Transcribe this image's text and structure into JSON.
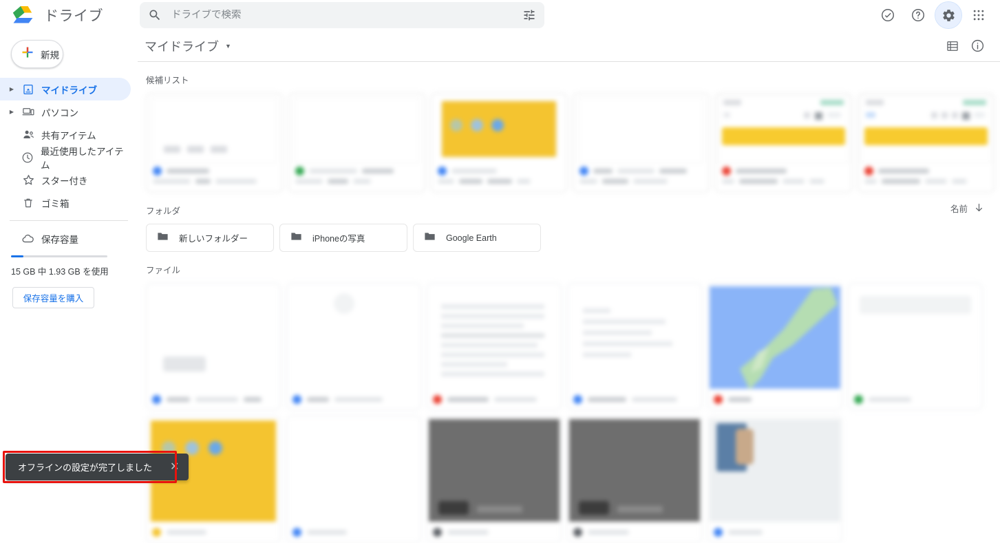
{
  "app": {
    "brand_name": "ドライブ",
    "logo_icon": "google-drive-logo"
  },
  "search": {
    "placeholder": "ドライブで検索",
    "value": "",
    "search_icon": "search-icon",
    "filter_icon": "tune-filter-icon"
  },
  "top_right": {
    "offline_status_icon": "check-circle-icon",
    "help_icon": "help-circle-icon",
    "settings_icon": "gear-icon",
    "settings_active": true,
    "apps_icon": "apps-grid-icon"
  },
  "sidebar": {
    "new_button": {
      "label": "新規",
      "icon": "plus-icon"
    },
    "items": [
      {
        "label": "マイドライブ",
        "icon": "my-drive-icon",
        "expandable": true,
        "active": true
      },
      {
        "label": "パソコン",
        "icon": "computer-icon",
        "expandable": true,
        "active": false
      },
      {
        "label": "共有アイテム",
        "icon": "shared-people-icon",
        "expandable": false,
        "active": false
      },
      {
        "label": "最近使用したアイテム",
        "icon": "clock-icon",
        "expandable": false,
        "active": false
      },
      {
        "label": "スター付き",
        "icon": "star-icon",
        "expandable": false,
        "active": false
      },
      {
        "label": "ゴミ箱",
        "icon": "trash-icon",
        "expandable": false,
        "active": false
      }
    ],
    "storage": {
      "label": "保存容量",
      "icon": "cloud-icon",
      "usage_text": "15 GB 中 1.93 GB を使用",
      "used_percent": 12.9,
      "buy_button_label": "保存容量を購入"
    }
  },
  "main": {
    "page_title": "マイドライブ",
    "title_caret_icon": "chevron-down-icon",
    "list_view_icon": "list-view-icon",
    "details_icon": "info-circle-icon",
    "suggested_label": "候補リスト",
    "folders_label": "フォルダ",
    "files_label": "ファイル",
    "sort": {
      "label": "名前",
      "direction_icon": "arrow-down-icon"
    },
    "folders": [
      {
        "name": "新しいフォルダー",
        "icon": "folder-icon"
      },
      {
        "name": "iPhoneの写真",
        "icon": "folder-icon"
      },
      {
        "name": "Google Earth",
        "icon": "folder-icon"
      }
    ],
    "suggested_cards": [
      {
        "type_color": "#4285f4",
        "thumb": "blank-document",
        "thumb_color": "#ffffff"
      },
      {
        "type_color": "#34a853",
        "thumb": "blank-sheet",
        "thumb_color": "#ffffff"
      },
      {
        "type_color": "#4285f4",
        "thumb": "yellow-slide",
        "thumb_color": "#f4c430"
      },
      {
        "type_color": "#4285f4",
        "thumb": "blank-document",
        "thumb_color": "#ffffff"
      },
      {
        "type_color": "#ea4335",
        "thumb": "yellow-bar-sheet",
        "thumb_color": "#f7cb2f"
      },
      {
        "type_color": "#ea4335",
        "thumb": "yellow-bar-sheet",
        "thumb_color": "#f7cb2f"
      }
    ],
    "file_cards": [
      {
        "type_color": "#4285f4",
        "thumb": "blank-page",
        "thumb_color": "#ffffff"
      },
      {
        "type_color": "#4285f4",
        "thumb": "blank-page",
        "thumb_color": "#ffffff"
      },
      {
        "type_color": "#ea4335",
        "thumb": "text-page",
        "thumb_color": "#ffffff"
      },
      {
        "type_color": "#4285f4",
        "thumb": "text-page",
        "thumb_color": "#ffffff"
      },
      {
        "type_color": "#ea4335",
        "thumb": "map-thumbnail",
        "thumb_color": "#8ab4f8"
      },
      {
        "type_color": "#34a853",
        "thumb": "blank-sheet",
        "thumb_color": "#ffffff"
      },
      {
        "type_color": "#f4c430",
        "thumb": "yellow-slide",
        "thumb_color": "#f4c430"
      },
      {
        "type_color": "#4285f4",
        "thumb": "blank-page",
        "thumb_color": "#ffffff"
      },
      {
        "type_color": "#5f6368",
        "thumb": "dark-video",
        "thumb_color": "#6e6e6e"
      },
      {
        "type_color": "#5f6368",
        "thumb": "dark-video",
        "thumb_color": "#6e6e6e"
      },
      {
        "type_color": "#4285f4",
        "thumb": "photo",
        "thumb_color": "#cfd8e3"
      }
    ]
  },
  "toast": {
    "message": "オフラインの設定が完了しました",
    "close_icon": "close-icon",
    "highlight_color": "#e8130e"
  }
}
